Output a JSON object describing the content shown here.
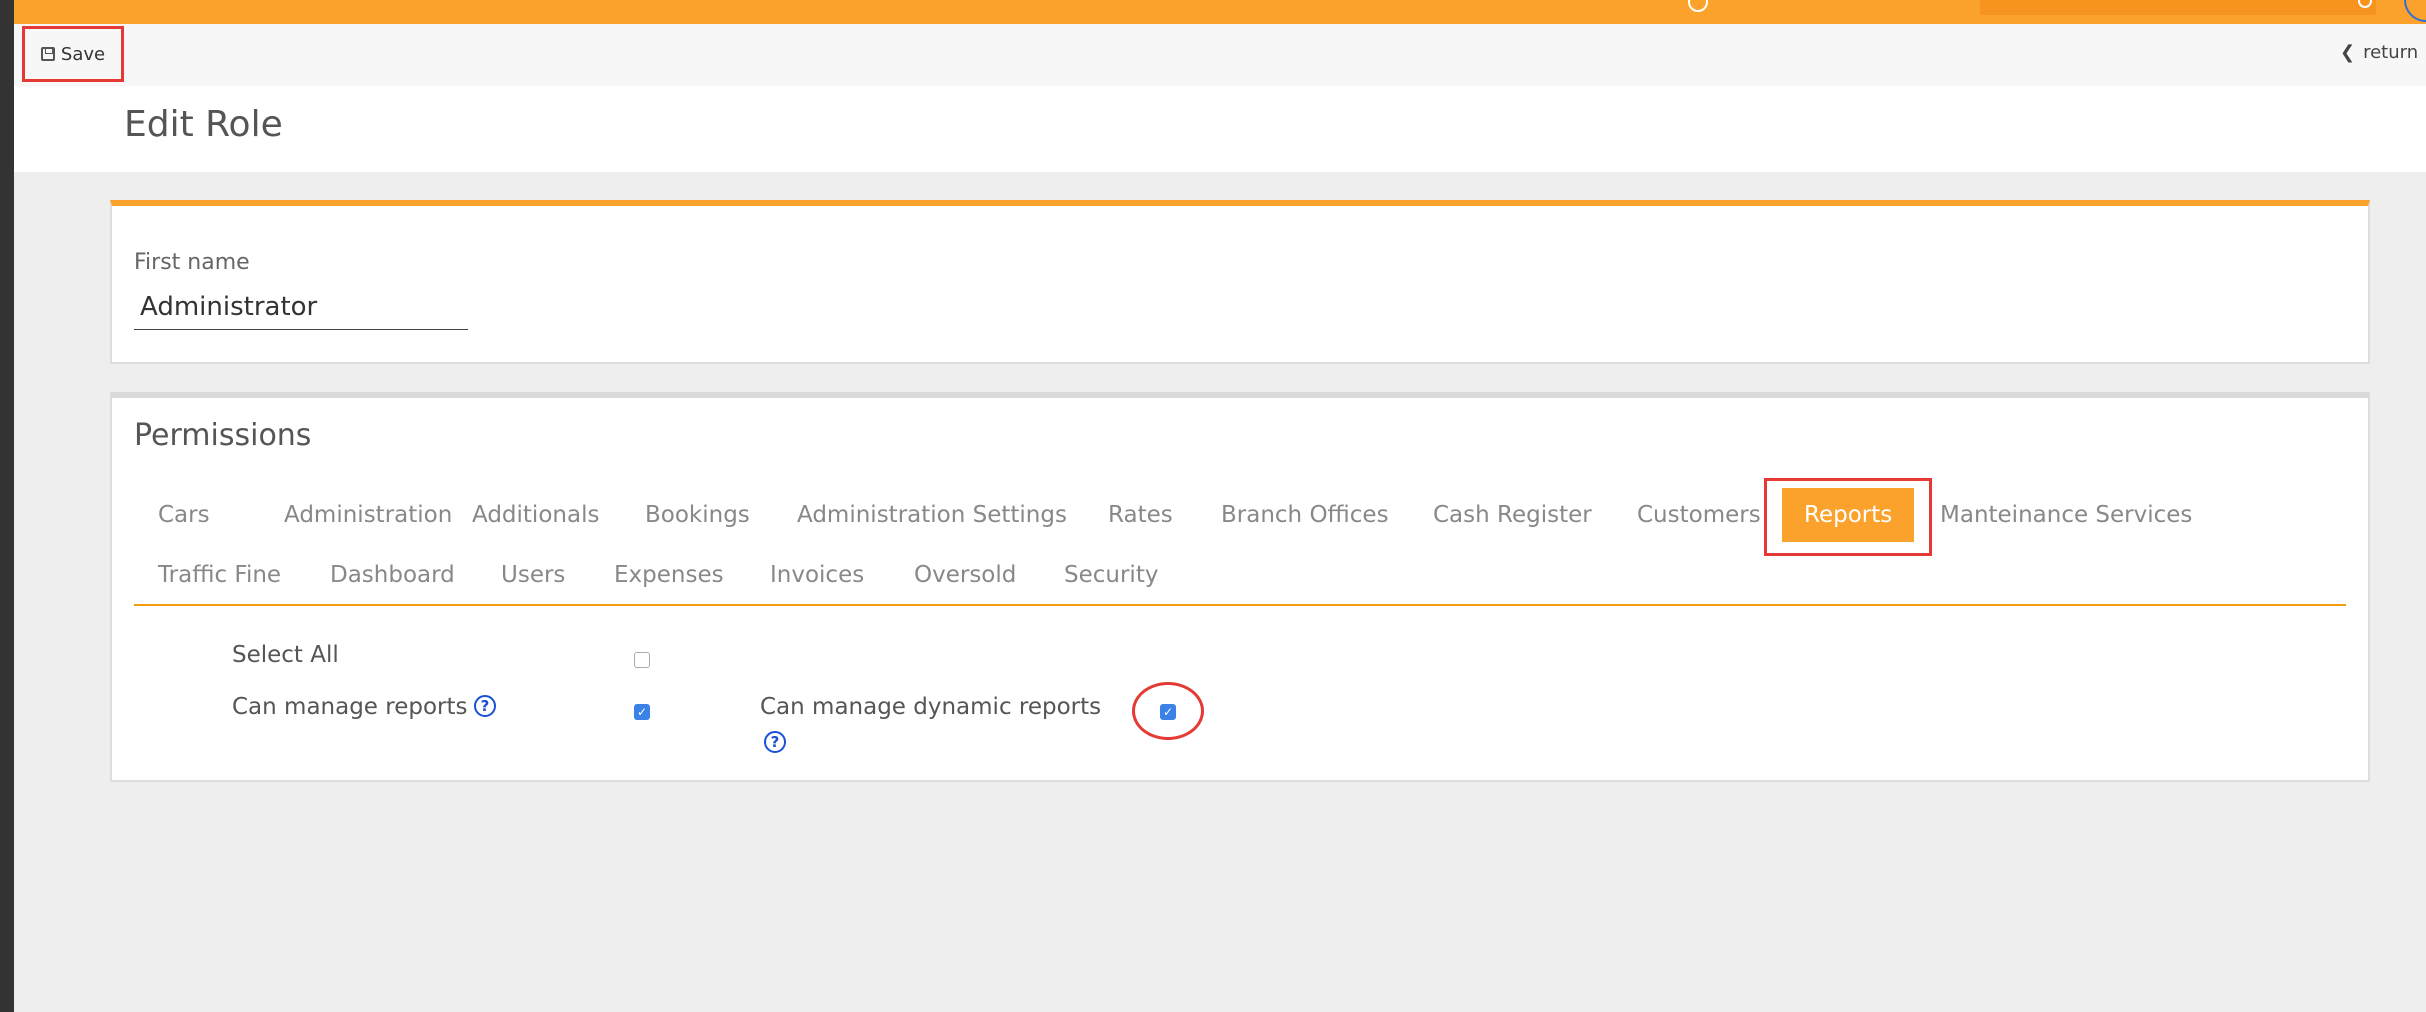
{
  "toolbar": {
    "save_label": "Save",
    "return_label": "return"
  },
  "page": {
    "title": "Edit Role"
  },
  "role_form": {
    "first_name_label": "First name",
    "first_name_value": "Administrator"
  },
  "permissions": {
    "title": "Permissions",
    "tabs": [
      {
        "label": "Cars",
        "active": false
      },
      {
        "label": "Administration",
        "active": false
      },
      {
        "label": "Additionals",
        "active": false
      },
      {
        "label": "Bookings",
        "active": false
      },
      {
        "label": "Administration Settings",
        "active": false
      },
      {
        "label": "Rates",
        "active": false
      },
      {
        "label": "Branch Offices",
        "active": false
      },
      {
        "label": "Cash Register",
        "active": false
      },
      {
        "label": "Customers",
        "active": false
      },
      {
        "label": "Reports",
        "active": true
      },
      {
        "label": "Manteinance Services",
        "active": false
      },
      {
        "label": "Traffic Fine",
        "active": false
      },
      {
        "label": "Dashboard",
        "active": false
      },
      {
        "label": "Users",
        "active": false
      },
      {
        "label": "Expenses",
        "active": false
      },
      {
        "label": "Invoices",
        "active": false
      },
      {
        "label": "Oversold",
        "active": false
      },
      {
        "label": "Security",
        "active": false
      }
    ],
    "select_all_label": "Select All",
    "select_all_checked": false,
    "items": [
      {
        "label": "Can manage reports",
        "checked": true,
        "help": "?"
      },
      {
        "label": "Can manage dynamic reports",
        "checked": true,
        "help": "?"
      }
    ]
  },
  "colors": {
    "accent": "#fba22c",
    "highlight": "#e53935",
    "checkbox": "#3b82e6",
    "help": "#1a4fd8"
  }
}
